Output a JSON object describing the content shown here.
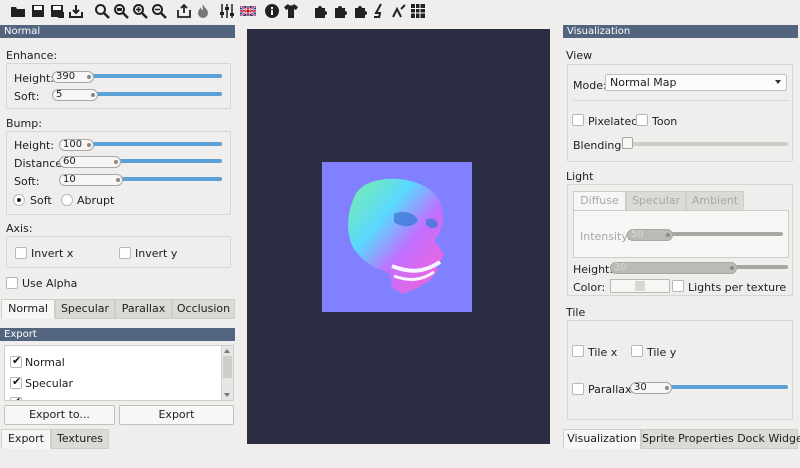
{
  "toolbar": {
    "icons": [
      "folder-open-icon",
      "save-icon",
      "save-as-icon",
      "export-icon",
      "zoom-fit-icon",
      "zoom-reset-icon",
      "zoom-in-icon",
      "zoom-out-icon",
      "share-icon",
      "fire-icon",
      "sliders-icon",
      "language-flag-icon",
      "info-icon",
      "shirt-icon",
      "puzzle-icon",
      "puzzle-icon",
      "puzzle-icon",
      "paint-icon",
      "brush-icon",
      "grid-icon"
    ]
  },
  "normal_panel": {
    "title": "Normal",
    "enhance": {
      "label": "Enhance:",
      "height_label": "Height:",
      "height_value": "390",
      "soft_label": "Soft:",
      "soft_value": "5"
    },
    "bump": {
      "label": "Bump:",
      "height_label": "Height:",
      "height_value": "100",
      "distance_label": "Distance:",
      "distance_value": "60",
      "soft_label": "Soft:",
      "soft_value": "10",
      "soft_radio": "Soft",
      "abrupt_radio": "Abrupt"
    },
    "axis": {
      "label": "Axis:",
      "invert_x": "Invert x",
      "invert_y": "Invert y"
    },
    "use_alpha": "Use Alpha",
    "tabs": [
      "Normal",
      "Specular",
      "Parallax",
      "Occlusion"
    ]
  },
  "export_panel": {
    "title": "Export",
    "items": [
      "Normal",
      "Specular"
    ],
    "export_to_button": "Export to...",
    "export_button": "Export",
    "tabs": [
      "Export",
      "Textures"
    ]
  },
  "visualization": {
    "title": "Visualization",
    "view_label": "View",
    "mode_label": "Mode:",
    "mode_value": "Normal Map",
    "pixelated": "Pixelated",
    "toon": "Toon",
    "blending_label": "Blending:",
    "light_label": "Light",
    "light_tabs": [
      "Diffuse",
      "Specular",
      "Ambient"
    ],
    "intensity_label": "Intensity:",
    "intensity_value": "50",
    "height_label": "Height:",
    "height_value": "30",
    "color_label": "Color:",
    "lights_per_texture": "Lights per texture",
    "tile_label": "Tile",
    "tile_x": "Tile x",
    "tile_y": "Tile y",
    "parallax": "Parallax",
    "parallax_value": "30",
    "bottom_tabs": [
      "Visualization",
      "Sprite Properties Dock Widget"
    ]
  },
  "colors": {
    "accent": "#5aa1d8",
    "dock_title": "#53647f",
    "viewport": "#2c2c43",
    "normal_bg": "#8181ff"
  }
}
